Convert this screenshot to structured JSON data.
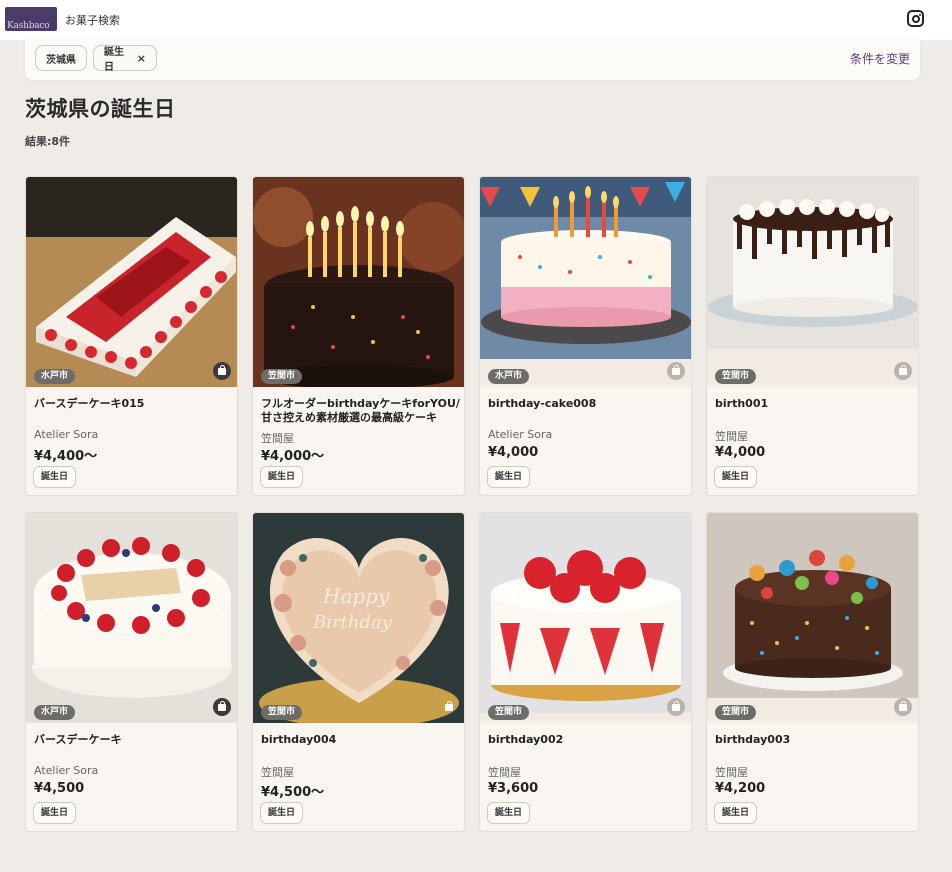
{
  "header": {
    "logo_text": "Kashbaco",
    "site_title": "お菓子検索",
    "instagram_icon": "instagram-icon"
  },
  "filters": {
    "chips": [
      {
        "label": "茨城県",
        "removable": false
      },
      {
        "label": "誕生日",
        "removable": true,
        "remove_glyph": "×"
      }
    ],
    "change_link": "条件を変更"
  },
  "page": {
    "title": "茨城県の誕生日",
    "result_count": "結果:8件"
  },
  "colors": {
    "accent": "#5b3d7a",
    "background": "#efebe6",
    "tag_bg": "#6e6c68"
  },
  "products": [
    {
      "area": "水戸市",
      "name": "バースデーケーキ015",
      "shop": "Atelier Sora",
      "price": "¥4,400〜",
      "tag": "誕生日",
      "bag_icon": "shopping-bag-icon"
    },
    {
      "area": "笠間市",
      "name": "フルオーダーbirthdayケーキforYOU/甘さ控えめ素材厳選の最高級ケーキ",
      "shop": "笠間屋",
      "price": "¥4,000〜",
      "tag": "誕生日",
      "bag_icon": "none"
    },
    {
      "area": "水戸市",
      "name": "birthday-cake008",
      "shop": "Atelier Sora",
      "price": "¥4,000",
      "tag": "誕生日",
      "bag_icon": "shopping-bag-icon"
    },
    {
      "area": "笠間市",
      "name": "birth001",
      "shop": "笠間屋",
      "price": "¥4,000",
      "tag": "誕生日",
      "bag_icon": "shopping-bag-icon"
    },
    {
      "area": "水戸市",
      "name": "バースデーケーキ",
      "shop": "Atelier Sora",
      "price": "¥4,500",
      "tag": "誕生日",
      "bag_icon": "shopping-bag-icon"
    },
    {
      "area": "笠間市",
      "name": "birthday004",
      "shop": "笠間屋",
      "price": "¥4,500〜",
      "tag": "誕生日",
      "bag_icon": "shopping-bag-icon"
    },
    {
      "area": "笠間市",
      "name": "birthday002",
      "shop": "笠間屋",
      "price": "¥3,600",
      "tag": "誕生日",
      "bag_icon": "shopping-bag-icon"
    },
    {
      "area": "笠間市",
      "name": "birthday003",
      "shop": "笠間屋",
      "price": "¥4,200",
      "tag": "誕生日",
      "bag_icon": "shopping-bag-icon"
    }
  ]
}
